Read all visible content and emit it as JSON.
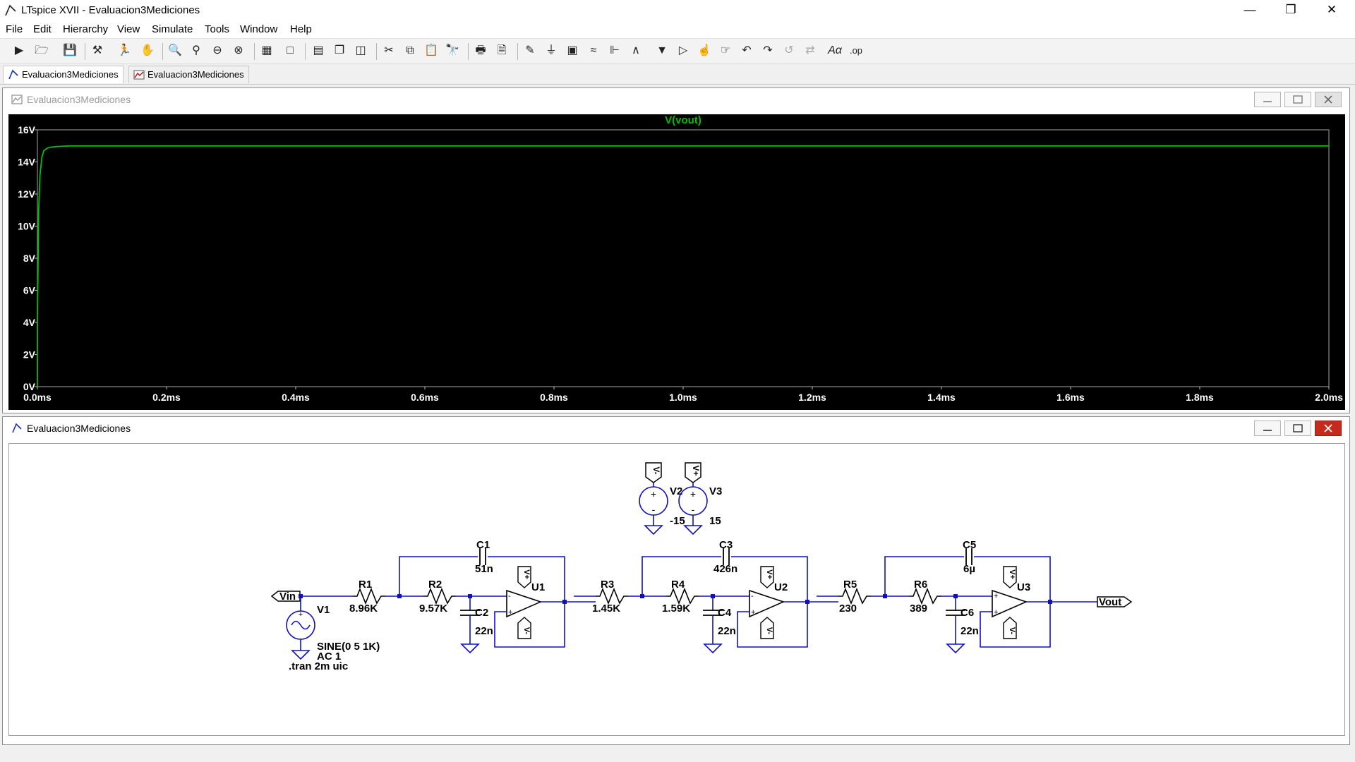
{
  "window": {
    "title": "LTspice XVII - Evaluacion3Mediciones"
  },
  "menu": [
    "File",
    "Edit",
    "Hierarchy",
    "View",
    "Simulate",
    "Tools",
    "Window",
    "Help"
  ],
  "tabs": [
    {
      "label": "Evaluacion3Mediciones",
      "icon": "schematic-icon",
      "active": true
    },
    {
      "label": "Evaluacion3Mediciones",
      "icon": "waveform-icon",
      "active": false
    }
  ],
  "waveform_window": {
    "title": "Evaluacion3Mediciones",
    "trace_label": "V(vout)",
    "trace_color": "#00c000",
    "background": "#000000"
  },
  "schematic_window": {
    "title": "Evaluacion3Mediciones"
  },
  "chart_data": {
    "type": "line",
    "title": "V(vout)",
    "xlabel": "",
    "ylabel": "",
    "x_ticks": [
      "0.0ms",
      "0.2ms",
      "0.4ms",
      "0.6ms",
      "0.8ms",
      "1.0ms",
      "1.2ms",
      "1.4ms",
      "1.6ms",
      "1.8ms",
      "2.0ms"
    ],
    "y_ticks": [
      "0V",
      "2V",
      "4V",
      "6V",
      "8V",
      "10V",
      "12V",
      "14V",
      "16V"
    ],
    "xlim": [
      0,
      2.0
    ],
    "ylim": [
      0,
      16
    ],
    "series": [
      {
        "name": "V(vout)",
        "x": [
          0.0,
          0.002,
          0.004,
          0.007,
          0.01,
          0.015,
          0.02,
          0.03,
          0.05,
          0.1,
          0.5,
          1.0,
          1.5,
          2.0
        ],
        "y": [
          4.0,
          11.0,
          13.2,
          14.3,
          14.7,
          14.85,
          14.92,
          14.96,
          15.0,
          15.0,
          15.0,
          15.0,
          15.0,
          15.0
        ]
      }
    ]
  },
  "schematic": {
    "labels": {
      "r1": "R1",
      "r1v": "8.96K",
      "r2": "R2",
      "r2v": "9.57K",
      "r3": "R3",
      "r3v": "1.45K",
      "r4": "R4",
      "r4v": "1.59K",
      "r5": "R5",
      "r5v": "230",
      "r6": "R6",
      "r6v": "389",
      "c1": "C1",
      "c1v": "51n",
      "c2": "C2",
      "c2v": "22n",
      "c3": "C3",
      "c3v": "426n",
      "c4": "C4",
      "c4v": "22n",
      "c5": "C5",
      "c5v": "6µ",
      "c6": "C6",
      "c6v": "22n",
      "u1": "U1",
      "u2": "U2",
      "u3": "U3",
      "v1": "V1",
      "v1v": "SINE(0 5 1K)",
      "v1ac": "AC 1",
      "v2": "V2",
      "v2v": "-15",
      "v3": "V3",
      "v3v": "15",
      "tran": ".tran 2m uic",
      "vin": "Vin",
      "vout": "Vout",
      "plus": "+",
      "minus": "-",
      "vplus": "V+",
      "vminus": "V-"
    }
  }
}
